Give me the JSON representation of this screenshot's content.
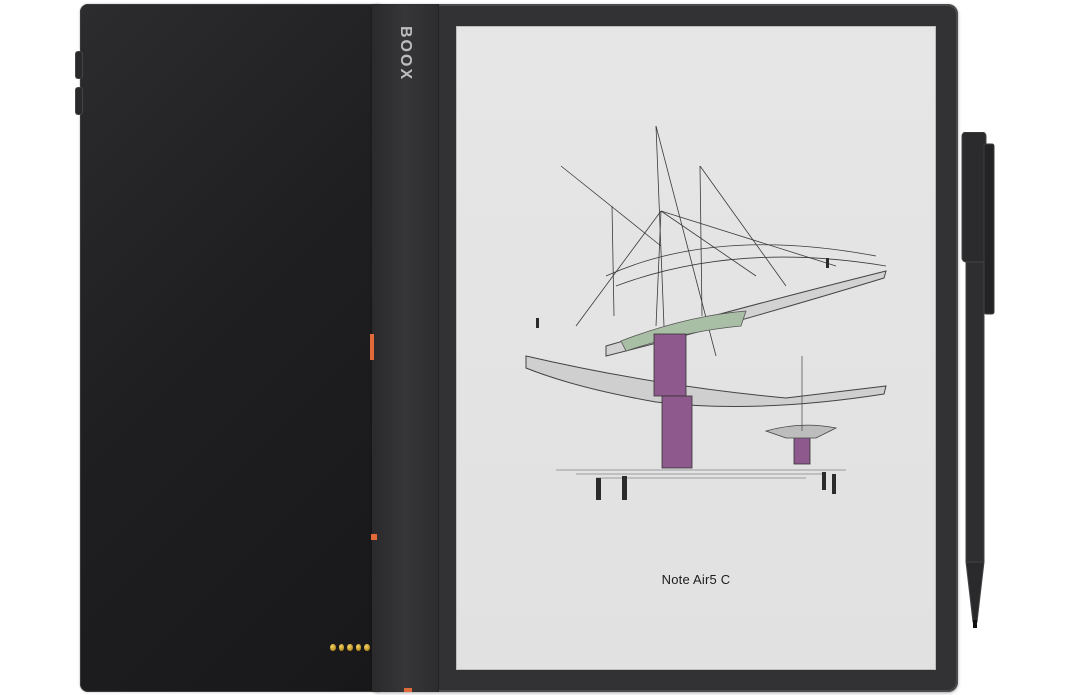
{
  "device": {
    "brand_logo": "BOOX",
    "screen_caption": "Note Air5 C"
  },
  "colors": {
    "accent": "#e06a3a",
    "body": "#323234",
    "cover": "#1f1f21",
    "screen": "#e3e3e3",
    "sketch_purple": "#8e5a8e",
    "sketch_green": "#9db59a"
  }
}
